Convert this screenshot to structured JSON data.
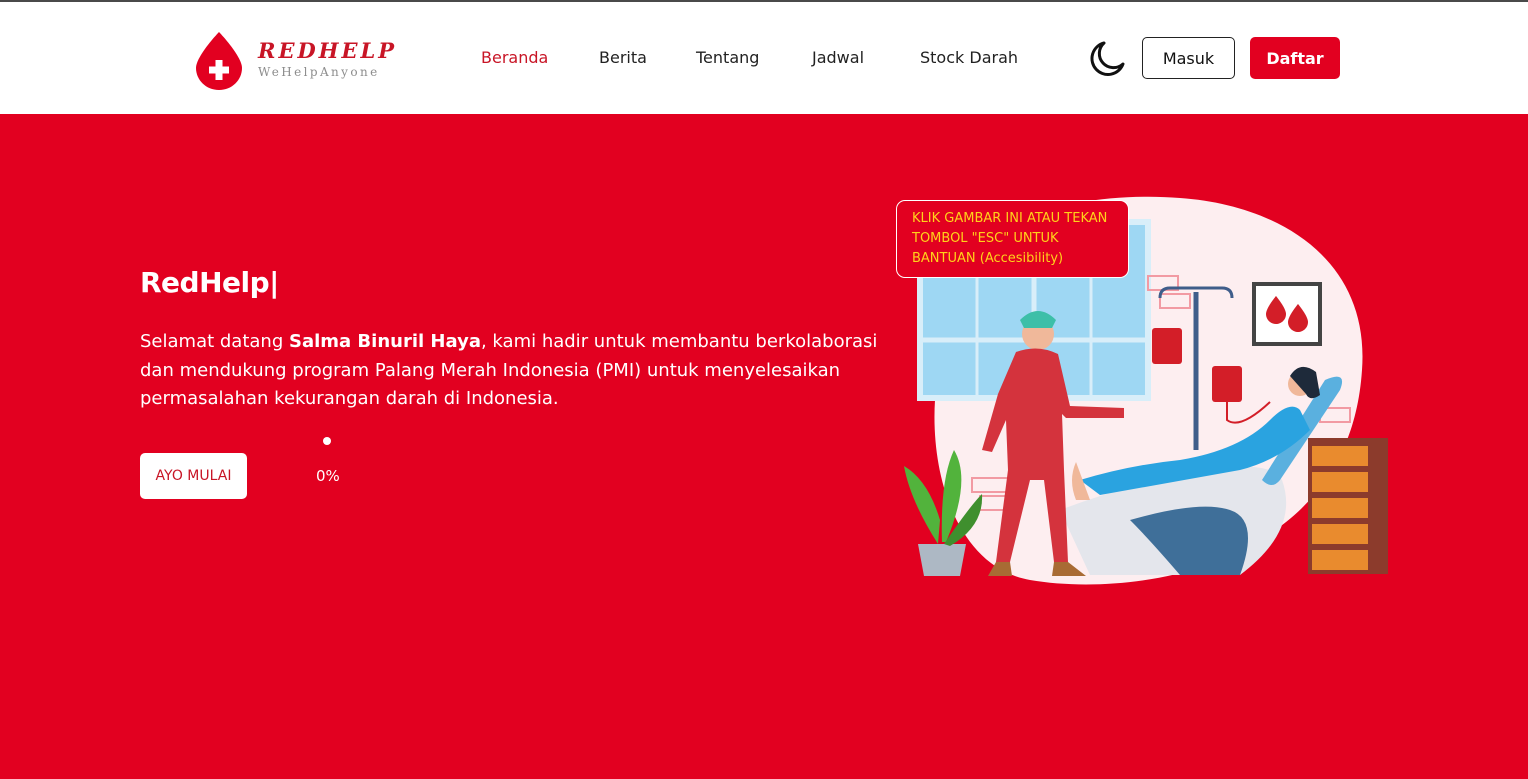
{
  "brand": {
    "name": "REDHELP",
    "tagline": "WeHelpAnyone",
    "color": "#c81526"
  },
  "nav": {
    "links": [
      {
        "label": "Beranda",
        "active": true
      },
      {
        "label": "Berita",
        "active": false
      },
      {
        "label": "Tentang",
        "active": false
      },
      {
        "label": "Jadwal",
        "active": false
      },
      {
        "label": "Stock Darah",
        "active": false
      }
    ],
    "theme_icon": "moon-icon",
    "login_label": "Masuk",
    "signup_label": "Daftar"
  },
  "hero": {
    "title": "RedHelp|",
    "text_before": "Selamat datang ",
    "user_name": "Salma Binuril Haya",
    "text_after": ", kami hadir untuk membantu berkolaborasi dan mendukung program Palang Merah Indonesia (PMI) untuk menyelesaikan permasalahan kekurangan darah di Indonesia.",
    "cta_label": "AYO MULAI",
    "slider_value": "0%",
    "background_color": "#e20020"
  },
  "tooltip": {
    "text": "KLIK GAMBAR INI ATAU TEKAN TOMBOL \"ESC\" UNTUK BANTUAN (Accesibility)",
    "color": "#ffd21a"
  },
  "illustration": {
    "name": "blood-donation-illustration"
  }
}
